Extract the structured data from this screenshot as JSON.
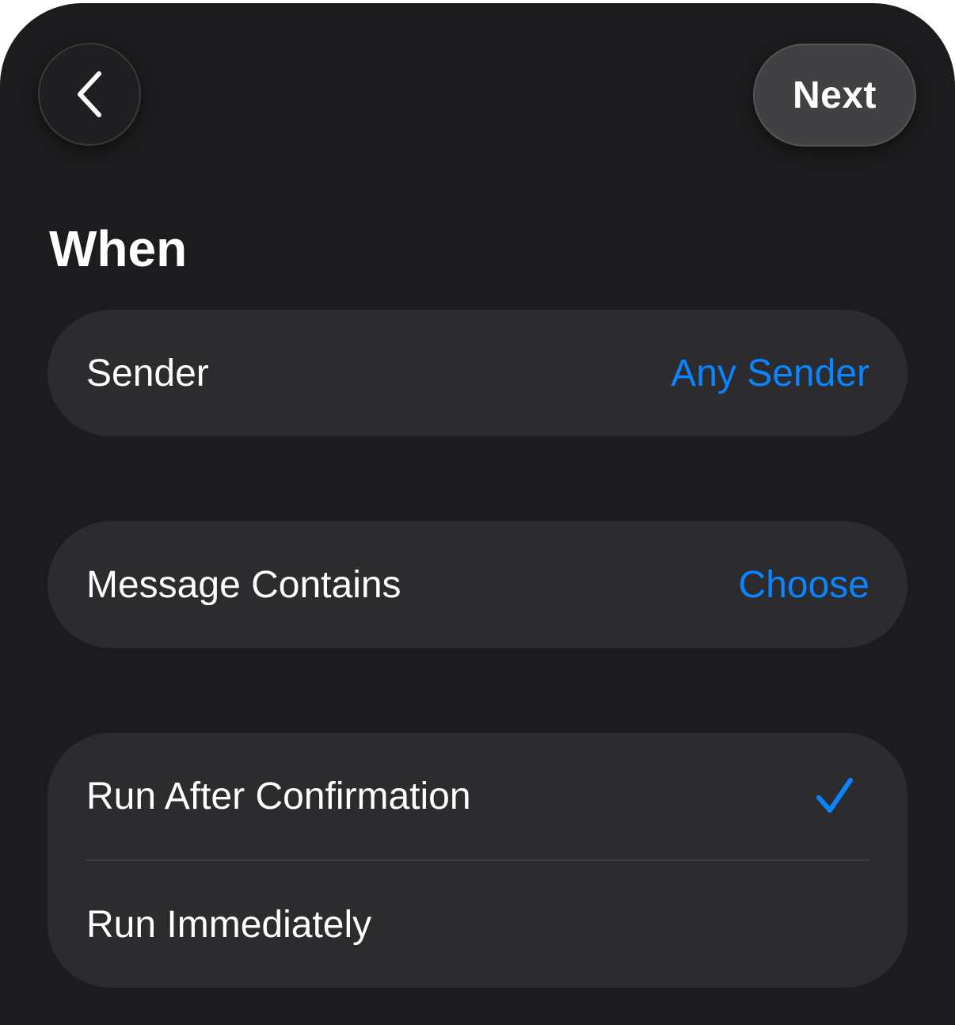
{
  "nav": {
    "back_icon": "chevron-left-icon",
    "next_label": "Next"
  },
  "section": {
    "title": "When"
  },
  "sender_row": {
    "label": "Sender",
    "value": "Any Sender"
  },
  "contains_row": {
    "label": "Message Contains",
    "value": "Choose"
  },
  "run_options": {
    "items": [
      {
        "label": "Run After Confirmation",
        "selected": true,
        "icon": "checkmark-icon"
      },
      {
        "label": "Run Immediately",
        "selected": false
      }
    ]
  },
  "colors": {
    "background": "#1c1c1e",
    "card": "#2c2c2e",
    "accent": "#0a84ff",
    "text": "#ffffff"
  }
}
